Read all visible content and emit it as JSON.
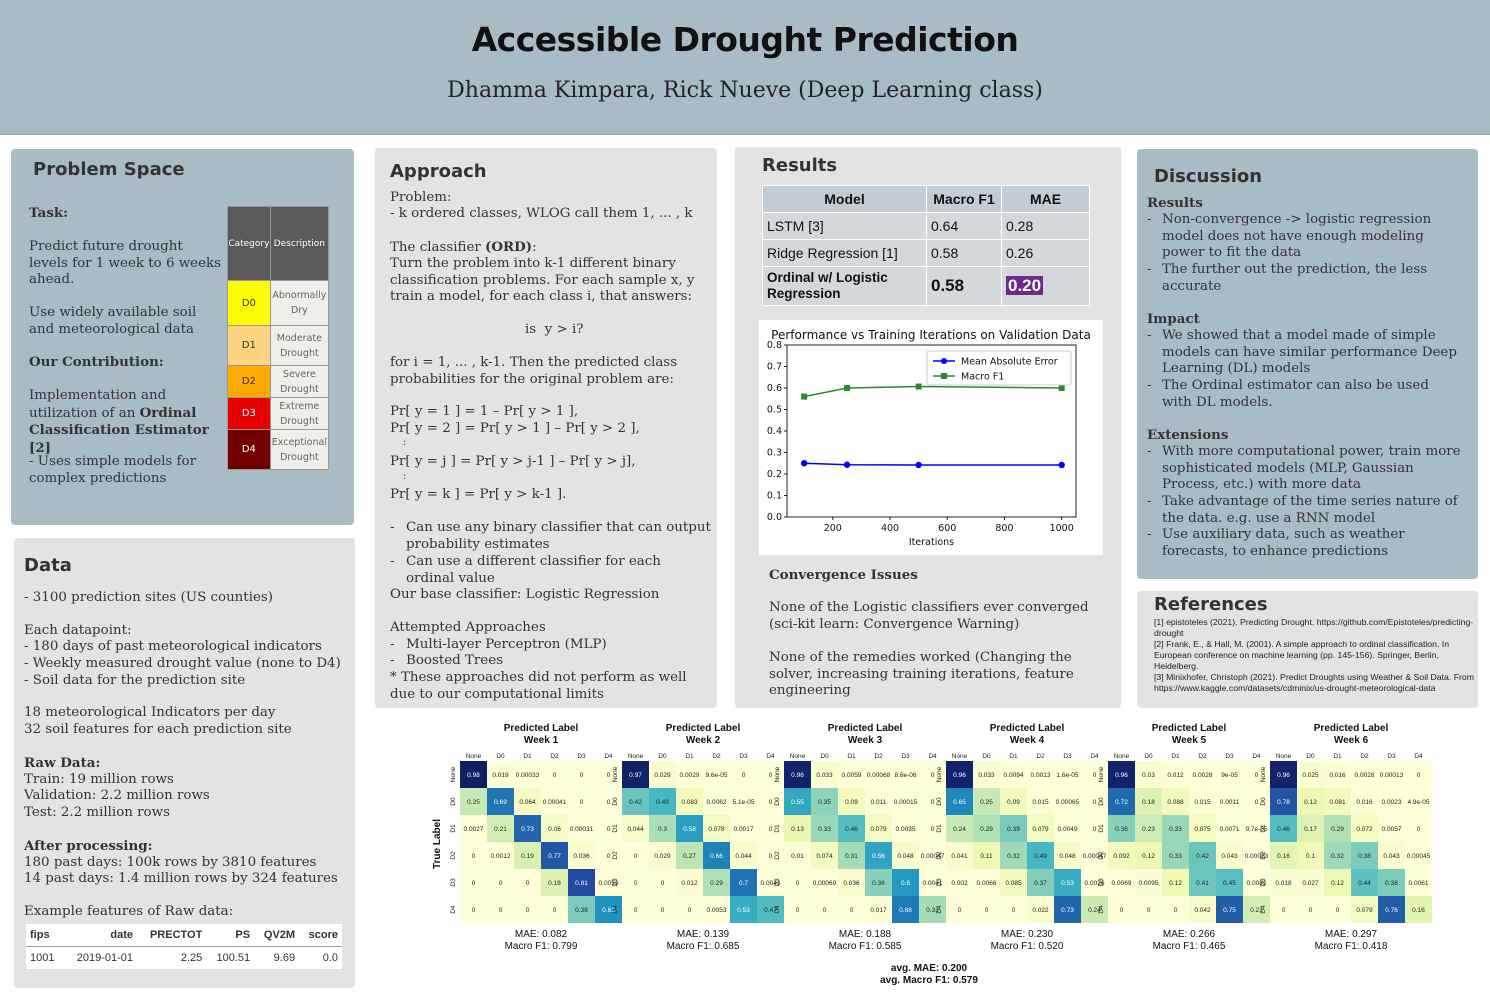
{
  "header": {
    "title": "Accessible Drought Prediction",
    "authors": "Dhamma Kimpara, Rick Nueve (Deep Learning class)"
  },
  "problem_space": {
    "title": "Problem Space",
    "task_label": "Task:",
    "task_text": "Predict future drought levels for 1 week to 6 weeks ahead.",
    "data_text": "Use widely available soil and meteorological data",
    "contribution_label": "Our Contribution:",
    "contribution_text_pre": "Implementation and utilization of an ",
    "contribution_text_bold": "Ordinal Classification Estimator [2]",
    "simple_text": "- Uses simple models for complex predictions",
    "drought_table": {
      "headers": [
        "Category",
        "Description"
      ],
      "rows": [
        {
          "cat": "D0",
          "desc": "Abnormally Dry",
          "color": "#fdfc00"
        },
        {
          "cat": "D1",
          "desc": "Moderate Drought",
          "color": "#fcd37f"
        },
        {
          "cat": "D2",
          "desc": "Severe Drought",
          "color": "#ffaa00"
        },
        {
          "cat": "D3",
          "desc": "Extreme Drought",
          "color": "#e60000"
        },
        {
          "cat": "D4",
          "desc": "Exceptional Drought",
          "color": "#730000"
        }
      ]
    }
  },
  "data_panel": {
    "title": "Data",
    "sites": "- 3100 prediction sites (US counties)",
    "datapoint_label": "Each datapoint:",
    "datapoint_items": [
      "- 180 days of past meteorological indicators",
      "- Weekly measured drought value (none to D4)",
      "- Soil data for the prediction site"
    ],
    "indicators": "18 meteorological Indicators per day",
    "soil": "32 soil features for each prediction site",
    "raw_label": "Raw Data:",
    "raw_items": [
      "Train: 19 million rows",
      "Validation: 2.2 million rows",
      "Test: 2.2 million rows"
    ],
    "after_label": "After processing:",
    "after_items": [
      "180 past days: 100k rows by 3810 features",
      "14 past days: 1.4 million rows by 324 features"
    ],
    "example_label": "Example features of Raw data:",
    "example_table": {
      "headers": [
        "fips",
        "date",
        "PRECTOT",
        "PS",
        "QV2M",
        "score"
      ],
      "row": [
        "1001",
        "2019-01-01",
        "2.25",
        "100.51",
        "9.69",
        "0.0"
      ]
    }
  },
  "approach": {
    "title": "Approach",
    "problem_label": "Problem:",
    "problem_text": "- k ordered classes, WLOG call them 1, ... , k",
    "classifier_pre": "The classifier ",
    "classifier_bold": "(ORD)",
    "classifier_post": ":",
    "classifier_text": "Turn the problem into k-1 different binary classification problems. For each sample x, y train a model, for each class i, that answers:",
    "question": "is  y > i?",
    "for_text": "for i = 1, ... , k-1. Then the predicted class probabilities for the original problem are:",
    "formulas": [
      "Pr[ y = 1 ] = 1 – Pr[ y > 1 ],",
      "Pr[ y = 2 ] = Pr[ y > 1 ] – Pr[ y > 2 ],",
      "Pr[ y = j ] = Pr[ y > j-1 ] – Pr[ y > j],",
      "Pr[ y = k ] = Pr[ y > k-1 ]."
    ],
    "vdots": ":",
    "bullets": [
      "Can use any binary classifier that can output probability estimates",
      "Can use a different classifier for each ordinal value"
    ],
    "base": "Our base classifier: Logistic Regression",
    "attempted_label": "Attempted Approaches",
    "attempted_items": [
      "Multi-layer Perceptron (MLP)",
      "Boosted Trees"
    ],
    "note": "* These approaches did not perform as well due to our computational limits"
  },
  "results": {
    "title": "Results",
    "table": {
      "headers": [
        "Model",
        "Macro F1",
        "MAE"
      ],
      "rows": [
        [
          "LSTM [3]",
          "0.64",
          "0.28"
        ],
        [
          "Ridge Regression [1]",
          "0.58",
          "0.26"
        ],
        [
          "Ordinal w/ Logistic Regression",
          "0.58",
          "0.20"
        ]
      ]
    },
    "convergence_label": "Convergence Issues",
    "convergence_text": "None of the Logistic classifiers ever converged (sci-kit learn: Convergence Warning)",
    "remedies_text": "None of the remedies worked (Changing the solver, increasing training iterations, feature engineering"
  },
  "discussion": {
    "title": "Discussion",
    "results_label": "Results",
    "results_items": [
      "Non-convergence -> logistic regression model does not have enough modeling power to fit the data",
      "The further out the prediction, the less accurate"
    ],
    "impact_label": "Impact",
    "impact_items": [
      "We showed that a model made of simple models can have similar performance Deep Learning (DL) models",
      "The Ordinal estimator can also be used with DL models."
    ],
    "extensions_label": "Extensions",
    "extensions_items": [
      "With more computational power, train more sophisticated models (MLP, Gaussian Process, etc.) with more data",
      "Take advantage of the time series nature of the data. e.g. use a RNN model",
      "Use auxiliary data, such as weather forecasts, to enhance predictions"
    ]
  },
  "references": {
    "title": "References",
    "items": [
      "[1] epistoteles (2021). Predicting Drought. https://github.com/Epistoteles/predicting-drought",
      "[2] Frank, E., & Hall, M. (2001). A simple approach to ordinal classification. In European conference on machine learning (pp. 145-156). Springer, Berlin, Heidelberg.",
      "[3] Minixhofer, Christoph (2021). Predict Droughts using Weather & Soil Data. From https://www.kaggle.com/datasets/cdminix/us-drought-meteorological-data"
    ]
  },
  "chart_data": [
    {
      "type": "line",
      "title": "Performance vs Training Iterations on Validation Data",
      "xlabel": "Iterations",
      "ylabel": "",
      "x": [
        100,
        250,
        500,
        1000
      ],
      "series": [
        {
          "name": "Mean Absolute Error",
          "values": [
            0.25,
            0.243,
            0.242,
            0.242
          ],
          "color": "#0000ff"
        },
        {
          "name": "Macro F1",
          "values": [
            0.56,
            0.6,
            0.607,
            0.6
          ],
          "color": "#2a8a2a"
        }
      ],
      "xlim": [
        40,
        1050
      ],
      "ylim": [
        0.0,
        0.8
      ],
      "xticks": [
        200,
        400,
        600,
        800,
        1000
      ],
      "yticks": [
        0.0,
        0.1,
        0.2,
        0.3,
        0.4,
        0.5,
        0.6,
        0.7,
        0.8
      ],
      "legend": "top-right",
      "grid": false
    },
    {
      "type": "heatmap",
      "xlabel": "Predicted Label",
      "ylabel": "True Label",
      "labels": [
        "None",
        "D0",
        "D1",
        "D2",
        "D3",
        "D4"
      ],
      "footer_avg_mae": "avg. MAE: 0.200",
      "footer_avg_f1": "avg. Macro F1: 0.579",
      "matrices": [
        {
          "title": "Week 1",
          "mae": "MAE: 0.082",
          "f1": "Macro F1: 0.799",
          "cells": [
            [
              "0.98",
              "0.019",
              "0.00033",
              "0",
              "0",
              "0"
            ],
            [
              "0.25",
              "0.69",
              "0.064",
              "0.00041",
              "0",
              "0"
            ],
            [
              "0.0027",
              "0.21",
              "0.73",
              "0.06",
              "0.00031",
              "0"
            ],
            [
              "0",
              "0.0012",
              "0.19",
              "0.77",
              "0.036",
              "0"
            ],
            [
              "0",
              "0",
              "0",
              "0.18",
              "0.81",
              "0.0053"
            ],
            [
              "0",
              "0",
              "0",
              "0",
              "0.38",
              "0.62"
            ]
          ]
        },
        {
          "title": "Week 2",
          "mae": "MAE: 0.139",
          "f1": "Macro F1: 0.685",
          "cells": [
            [
              "0.97",
              "0.029",
              "0.0029",
              "9.6e-05",
              "0",
              "0"
            ],
            [
              "0.42",
              "0.49",
              "0.083",
              "0.0062",
              "5.1e-05",
              "0"
            ],
            [
              "0.044",
              "0.3",
              "0.58",
              "0.078",
              "0.0017",
              "0"
            ],
            [
              "0",
              "0.029",
              "0.27",
              "0.66",
              "0.044",
              "0"
            ],
            [
              "0",
              "0",
              "0.012",
              "0.29",
              "0.7",
              "0.0043"
            ],
            [
              "0",
              "0",
              "0",
              "0.0053",
              "0.53",
              "0.47"
            ]
          ]
        },
        {
          "title": "Week 3",
          "mae": "MAE: 0.188",
          "f1": "Macro F1: 0.585",
          "cells": [
            [
              "0.96",
              "0.033",
              "0.0059",
              "0.00068",
              "8.6e-06",
              "0"
            ],
            [
              "0.55",
              "0.35",
              "0.09",
              "0.011",
              "0.00015",
              "0"
            ],
            [
              "0.13",
              "0.33",
              "0.46",
              "0.079",
              "0.0035",
              "0"
            ],
            [
              "0.01",
              "0.074",
              "0.31",
              "0.56",
              "0.048",
              "0.00047"
            ],
            [
              "0",
              "0.00069",
              "0.036",
              "0.36",
              "0.6",
              "0.0041"
            ],
            [
              "0",
              "0",
              "0",
              "0.017",
              "0.68",
              "0.31"
            ]
          ]
        },
        {
          "title": "Week 4",
          "mae": "MAE: 0.230",
          "f1": "Macro F1: 0.520",
          "cells": [
            [
              "0.96",
              "0.033",
              "0.0094",
              "0.0013",
              "1.6e-05",
              "0"
            ],
            [
              "0.65",
              "0.25",
              "0.09",
              "0.015",
              "0.00065",
              "0"
            ],
            [
              "0.24",
              "0.29",
              "0.39",
              "0.079",
              "0.0049",
              "0"
            ],
            [
              "0.041",
              "0.11",
              "0.32",
              "0.49",
              "0.048",
              "0.00047"
            ],
            [
              "0.002",
              "0.0066",
              "0.085",
              "0.37",
              "0.53",
              "0.0026"
            ],
            [
              "0",
              "0",
              "0",
              "0.022",
              "0.73",
              "0.24"
            ]
          ]
        },
        {
          "title": "Week 5",
          "mae": "MAE: 0.266",
          "f1": "Macro F1: 0.465",
          "cells": [
            [
              "0.96",
              "0.03",
              "0.012",
              "0.0028",
              "9e-05",
              "0"
            ],
            [
              "0.72",
              "0.18",
              "0.088",
              "0.015",
              "0.0011",
              "0"
            ],
            [
              "0.36",
              "0.23",
              "0.33",
              "0.075",
              "0.0071",
              "9.7e-05"
            ],
            [
              "0.092",
              "0.12",
              "0.33",
              "0.42",
              "0.043",
              "0.00023"
            ],
            [
              "0.0069",
              "0.0095",
              "0.12",
              "0.41",
              "0.45",
              "0.0082"
            ],
            [
              "0",
              "0",
              "0",
              "0.042",
              "0.75",
              "0.21"
            ]
          ]
        },
        {
          "title": "Week 6",
          "mae": "MAE: 0.297",
          "f1": "Macro F1: 0.418",
          "cells": [
            [
              "0.96",
              "0.025",
              "0.016",
              "0.0028",
              "0.00013",
              "0"
            ],
            [
              "0.78",
              "0.12",
              "0.081",
              "0.016",
              "0.0023",
              "4.9e-05"
            ],
            [
              "0.46",
              "0.17",
              "0.29",
              "0.072",
              "0.0057",
              "0"
            ],
            [
              "0.16",
              "0.1",
              "0.32",
              "0.38",
              "0.043",
              "0.00045"
            ],
            [
              "0.018",
              "0.027",
              "0.12",
              "0.44",
              "0.38",
              "0.0061"
            ],
            [
              "0",
              "0",
              "0",
              "0.079",
              "0.76",
              "0.16"
            ]
          ]
        }
      ]
    }
  ]
}
